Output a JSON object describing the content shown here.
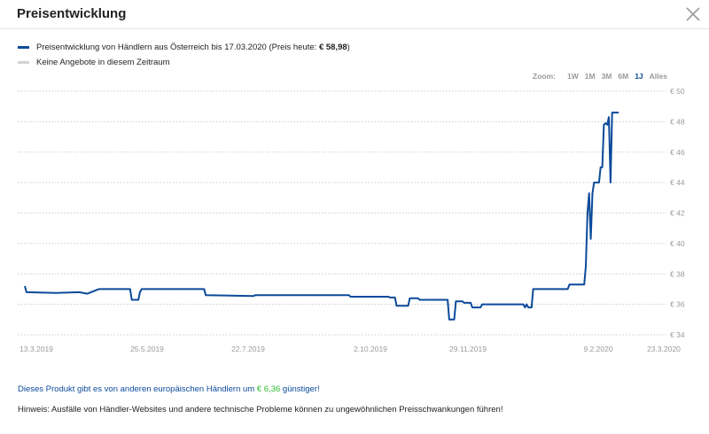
{
  "header": {
    "title": "Preisentwicklung"
  },
  "legend": {
    "series_label_prefix": "Preisentwicklung von Händlern aus Österreich bis 17.03.2020 (Preis heute: ",
    "series_price": "€ 58,98",
    "series_label_suffix": ")",
    "no_offers_label": "Keine Angebote in diesem Zeitraum"
  },
  "zoom": {
    "label": "Zoom:",
    "options": [
      "1W",
      "1M",
      "3M",
      "6M",
      "1J",
      "Alles"
    ],
    "active": "1J"
  },
  "colors": {
    "line": "#0b4a9a",
    "grid": "#cccccc",
    "green": "#2ebd2e"
  },
  "chart_data": {
    "type": "line",
    "x_tick_labels": [
      "13.3.2019",
      "25.5.2019",
      "22.7.2019",
      "2.10.2019",
      "29.11.2019",
      "9.2.2020",
      "23.3.2020"
    ],
    "y_tick_labels": [
      "€ 34",
      "€ 36",
      "€ 38",
      "€ 40",
      "€ 42",
      "€ 44",
      "€ 46",
      "€ 48",
      "€ 50"
    ],
    "ylim": [
      34,
      50
    ],
    "xlim": [
      "2019-03-13",
      "2020-03-23"
    ],
    "grid": true,
    "series": [
      {
        "points": [
          [
            "2019-03-13",
            37.2
          ],
          [
            "2019-03-14",
            36.8
          ],
          [
            "2019-04-01",
            36.75
          ],
          [
            "2019-04-15",
            36.8
          ],
          [
            "2019-04-20",
            36.7
          ],
          [
            "2019-04-27",
            37.0
          ],
          [
            "2019-05-16",
            37.0
          ],
          [
            "2019-05-17",
            36.3
          ],
          [
            "2019-05-21",
            36.3
          ],
          [
            "2019-05-22",
            36.8
          ],
          [
            "2019-05-23",
            37.0
          ],
          [
            "2019-06-30",
            37.0
          ],
          [
            "2019-07-01",
            36.6
          ],
          [
            "2019-07-30",
            36.55
          ],
          [
            "2019-07-31",
            36.6
          ],
          [
            "2019-09-26",
            36.6
          ],
          [
            "2019-09-27",
            36.5
          ],
          [
            "2019-10-20",
            36.5
          ],
          [
            "2019-10-21",
            36.45
          ],
          [
            "2019-10-24",
            36.45
          ],
          [
            "2019-10-25",
            35.9
          ],
          [
            "2019-11-01",
            35.9
          ],
          [
            "2019-11-02",
            36.4
          ],
          [
            "2019-11-07",
            36.4
          ],
          [
            "2019-11-08",
            36.3
          ],
          [
            "2019-11-25",
            36.3
          ],
          [
            "2019-11-26",
            35.0
          ],
          [
            "2019-11-29",
            35.0
          ],
          [
            "2019-11-30",
            36.2
          ],
          [
            "2019-12-04",
            36.2
          ],
          [
            "2019-12-05",
            36.1
          ],
          [
            "2019-12-09",
            36.1
          ],
          [
            "2019-12-10",
            35.8
          ],
          [
            "2019-12-15",
            35.8
          ],
          [
            "2019-12-16",
            36.0
          ],
          [
            "2020-01-10",
            36.0
          ],
          [
            "2020-01-11",
            35.8
          ],
          [
            "2020-01-12",
            36.0
          ],
          [
            "2020-01-13",
            35.8
          ],
          [
            "2020-01-15",
            35.8
          ],
          [
            "2020-01-16",
            37.0
          ],
          [
            "2020-02-06",
            37.0
          ],
          [
            "2020-02-07",
            37.3
          ],
          [
            "2020-02-16",
            37.3
          ],
          [
            "2020-02-17",
            38.5
          ],
          [
            "2020-02-18",
            42.0
          ],
          [
            "2020-02-19",
            43.3
          ],
          [
            "2020-02-20",
            40.3
          ],
          [
            "2020-02-21",
            43.3
          ],
          [
            "2020-02-22",
            44.0
          ],
          [
            "2020-02-25",
            44.0
          ],
          [
            "2020-02-26",
            45.0
          ],
          [
            "2020-02-27",
            45.0
          ],
          [
            "2020-02-28",
            47.8
          ],
          [
            "2020-02-29",
            47.9
          ],
          [
            "2020-03-01",
            47.8
          ],
          [
            "2020-03-02",
            48.3
          ],
          [
            "2020-03-03",
            44.0
          ],
          [
            "2020-03-04",
            48.6
          ],
          [
            "2020-03-08",
            48.6
          ]
        ]
      }
    ]
  },
  "notes": {
    "cheaper_prefix": "Dieses Produkt gibt es von anderen europäischen Händlern um ",
    "cheaper_amount": "€ 6,36",
    "cheaper_suffix": " günstiger!",
    "hint": "Hinweis: Ausfälle von Händler-Websites und andere technische Probleme können zu ungewöhnlichen Preisschwankungen führen!"
  }
}
